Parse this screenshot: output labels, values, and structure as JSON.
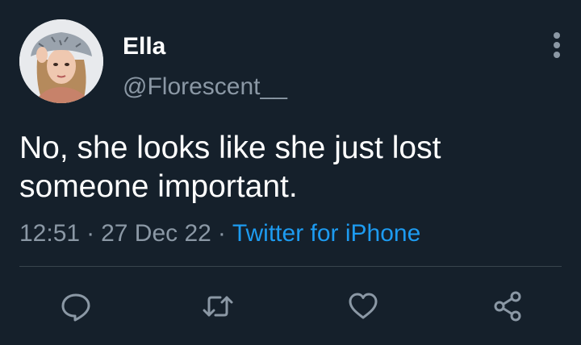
{
  "tweet": {
    "author": {
      "display_name": "Ella",
      "handle": "@Florescent__",
      "avatar_icon": "profile-photo"
    },
    "text_lines": [
      "No, she looks like she just lost",
      "someone important."
    ],
    "time": "12:51",
    "date": "27 Dec 22",
    "separator": "·",
    "source": "Twitter for iPhone",
    "more_icon": "more-vertical-icon",
    "actions": [
      {
        "name": "reply",
        "icon": "reply-icon"
      },
      {
        "name": "retweet",
        "icon": "retweet-icon"
      },
      {
        "name": "like",
        "icon": "heart-icon"
      },
      {
        "name": "share",
        "icon": "share-icon"
      }
    ],
    "colors": {
      "background": "#15202b",
      "primary_text": "#ffffff",
      "secondary_text": "#8b98a5",
      "link": "#1d9bf0",
      "divider": "#38444d"
    }
  }
}
